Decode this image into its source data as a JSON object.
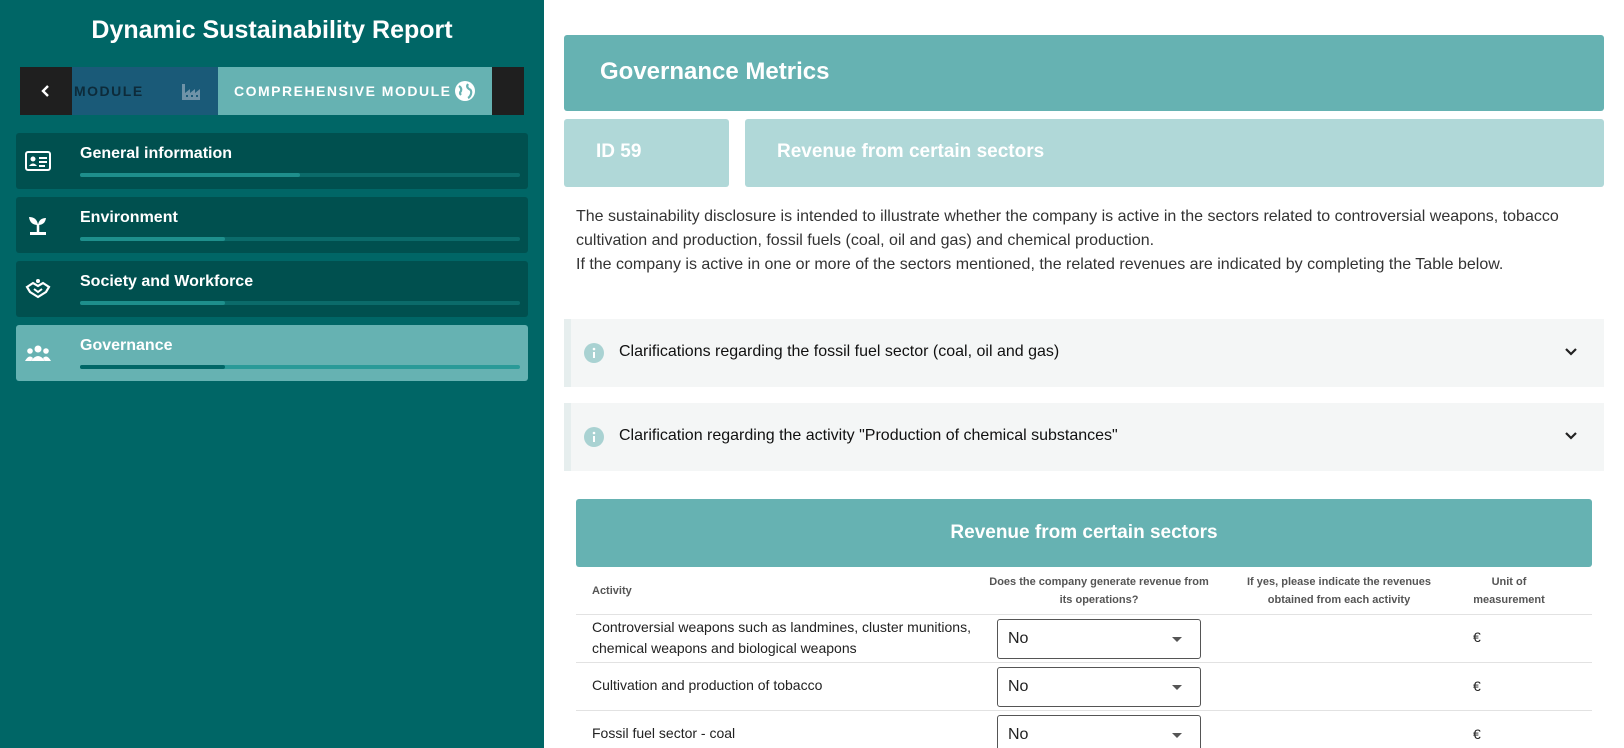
{
  "app": {
    "title": "Dynamic Sustainability Report"
  },
  "modules": {
    "back_icon": "chevron-left-icon",
    "basic_label": "MODULE",
    "basic_icon": "factory-icon",
    "comprehensive_label": "COMPREHENSIVE MODULE",
    "comprehensive_icon": "globe-icon"
  },
  "sidebar": {
    "items": [
      {
        "label": "General information",
        "icon": "id-card-icon",
        "progress": 0.5,
        "active": false
      },
      {
        "label": "Environment",
        "icon": "plant-icon",
        "progress": 0.33,
        "active": false
      },
      {
        "label": "Society and Workforce",
        "icon": "handshake-icon",
        "progress": 0.33,
        "active": false
      },
      {
        "label": "Governance",
        "icon": "people-icon",
        "progress": 0.33,
        "active": true
      }
    ]
  },
  "main": {
    "header_title": "Governance Metrics",
    "metric_id": "ID 59",
    "metric_title": "Revenue from certain sectors",
    "description": [
      "The sustainability disclosure is intended to illustrate whether the company is active in the sectors related to controversial weapons, tobacco cultivation and production, fossil fuels (coal, oil and gas) and chemical production.",
      "If the company is active in one or more of the sectors mentioned, the related revenues are indicated by completing the Table below."
    ],
    "accordions": [
      {
        "title": "Clarifications regarding the fossil fuel sector (coal, oil and gas)"
      },
      {
        "title": "Clarification regarding the activity \"Production of chemical substances\""
      }
    ],
    "table": {
      "title": "Revenue from certain sectors",
      "headers": {
        "activity": "Activity",
        "generate": "Does the company generate revenue from its operations?",
        "revenues": "If yes, please indicate the revenues obtained from each activity",
        "unit": "Unit of measurement"
      },
      "rows": [
        {
          "activity": "Controversial weapons such as landmines, cluster munitions, chemical weapons and biological weapons",
          "answer": "No",
          "unit": "€"
        },
        {
          "activity": "Cultivation and production of tobacco",
          "answer": "No",
          "unit": "€"
        },
        {
          "activity": "Fossil fuel sector - coal",
          "answer": "No",
          "unit": "€"
        }
      ]
    }
  },
  "colors": {
    "sidebar": "#006666",
    "accent": "#66b2b2",
    "light_accent": "#b0d8d8"
  }
}
